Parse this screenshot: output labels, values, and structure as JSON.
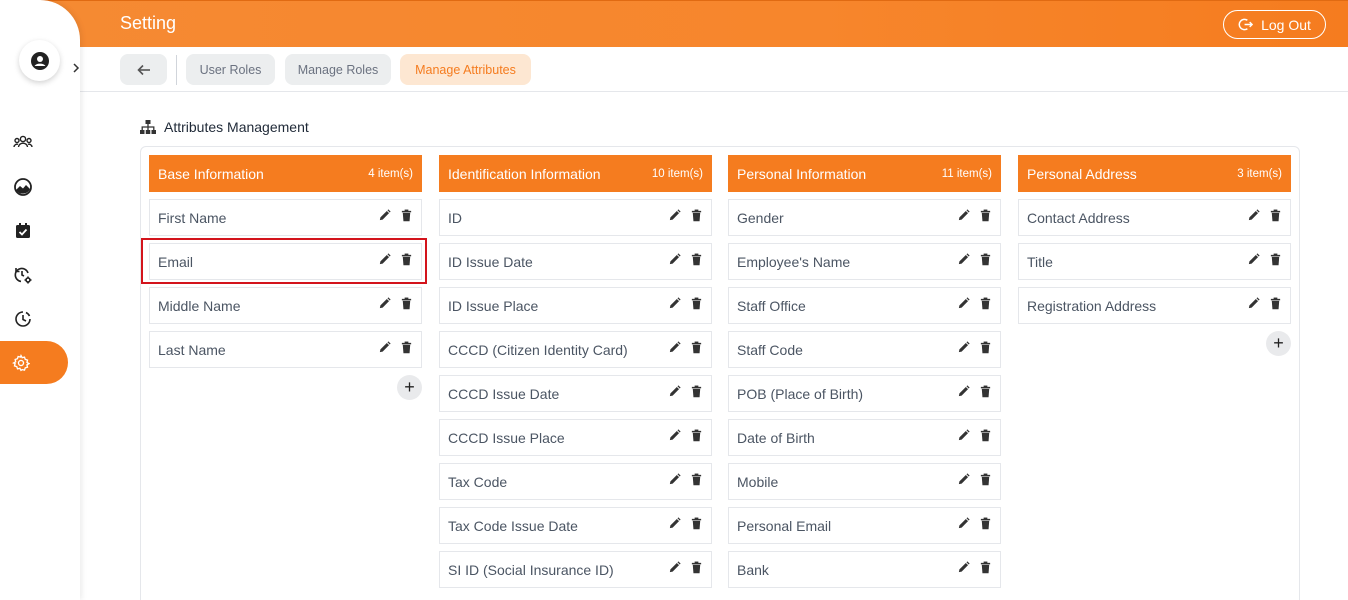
{
  "header": {
    "title": "Setting",
    "logout_label": "Log Out"
  },
  "subnav": {
    "tabs": [
      {
        "label": "User Roles"
      },
      {
        "label": "Manage Roles"
      },
      {
        "label": "Manage Attributes"
      }
    ]
  },
  "main": {
    "section_title": "Attributes Management",
    "columns": [
      {
        "title": "Base Information",
        "count": "4 item(s)",
        "items": [
          "First Name",
          "Email",
          "Middle Name",
          "Last Name"
        ]
      },
      {
        "title": "Identification Information",
        "count": "10 item(s)",
        "items": [
          "ID",
          "ID Issue Date",
          "ID Issue Place",
          "CCCD (Citizen Identity Card)",
          "CCCD Issue Date",
          "CCCD Issue Place",
          "Tax Code",
          "Tax Code Issue Date",
          "SI ID (Social Insurance ID)"
        ]
      },
      {
        "title": "Personal Information",
        "count": "11 item(s)",
        "items": [
          "Gender",
          "Employee's Name",
          "Staff Office",
          "Staff Code",
          "POB (Place of Birth)",
          "Date of Birth",
          "Mobile",
          "Personal Email",
          "Bank"
        ]
      },
      {
        "title": "Personal Address",
        "count": "3 item(s)",
        "items": [
          "Contact Address",
          "Title",
          "Registration Address"
        ]
      }
    ]
  },
  "colors": {
    "accent": "#f57c1f",
    "highlight": "#d3141c"
  },
  "icons": {
    "edit": "pencil-icon",
    "delete": "trash-icon",
    "add": "plus-icon"
  }
}
